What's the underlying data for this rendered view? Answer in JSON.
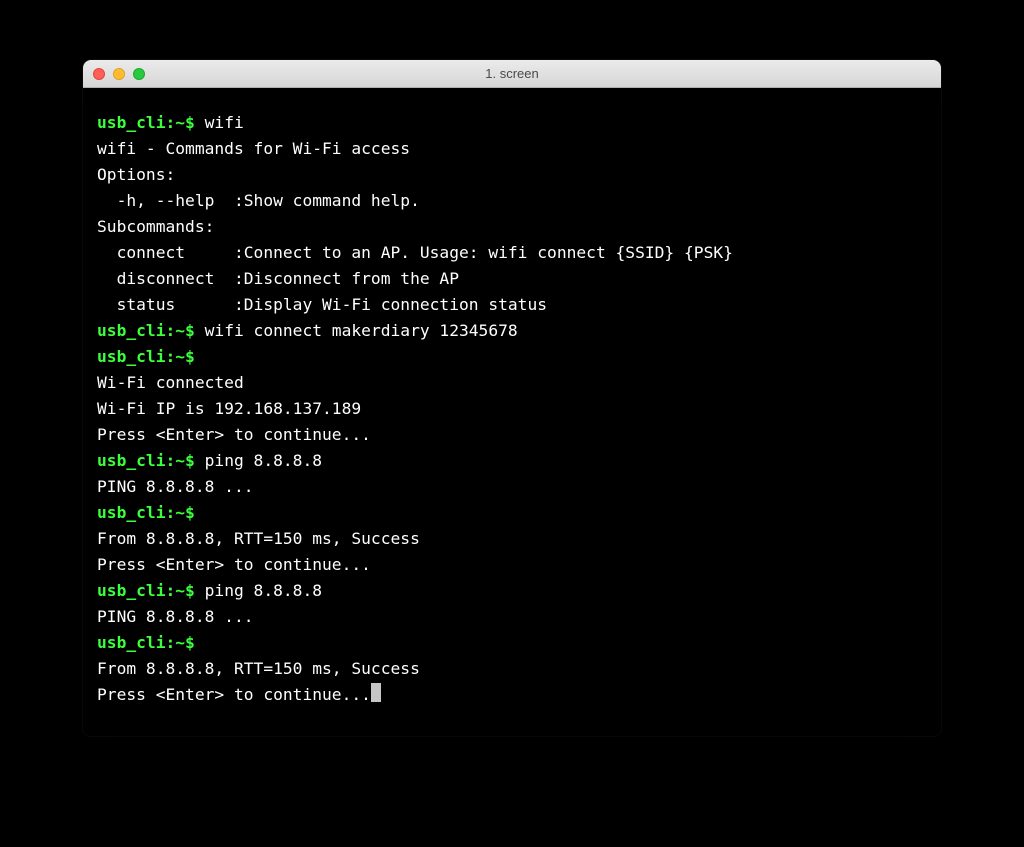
{
  "window": {
    "title": "1. screen"
  },
  "terminal": {
    "prompt": "usb_cli:~$ ",
    "lines": {
      "l0_cmd": "wifi",
      "l1": "wifi - Commands for Wi-Fi access",
      "l2": "Options:",
      "l3": "  -h, --help  :Show command help.",
      "l4": "Subcommands:",
      "l5": "  connect     :Connect to an AP. Usage: wifi connect {SSID} {PSK}",
      "l6": "  disconnect  :Disconnect from the AP",
      "l7": "  status      :Display Wi-Fi connection status",
      "l8_cmd": "wifi connect makerdiary 12345678",
      "l9_cmd": "",
      "l10": "Wi-Fi connected",
      "l11": "Wi-Fi IP is 192.168.137.189",
      "l12": "Press <Enter> to continue...",
      "l13_cmd": "ping 8.8.8.8",
      "l14": "PING 8.8.8.8 ...",
      "l15_cmd": "",
      "l16": "From 8.8.8.8, RTT=150 ms, Success",
      "l17": "Press <Enter> to continue...",
      "l18_cmd": "ping 8.8.8.8",
      "l19": "PING 8.8.8.8 ...",
      "l20_cmd": "",
      "l21": "From 8.8.8.8, RTT=150 ms, Success",
      "l22": "Press <Enter> to continue..."
    }
  }
}
